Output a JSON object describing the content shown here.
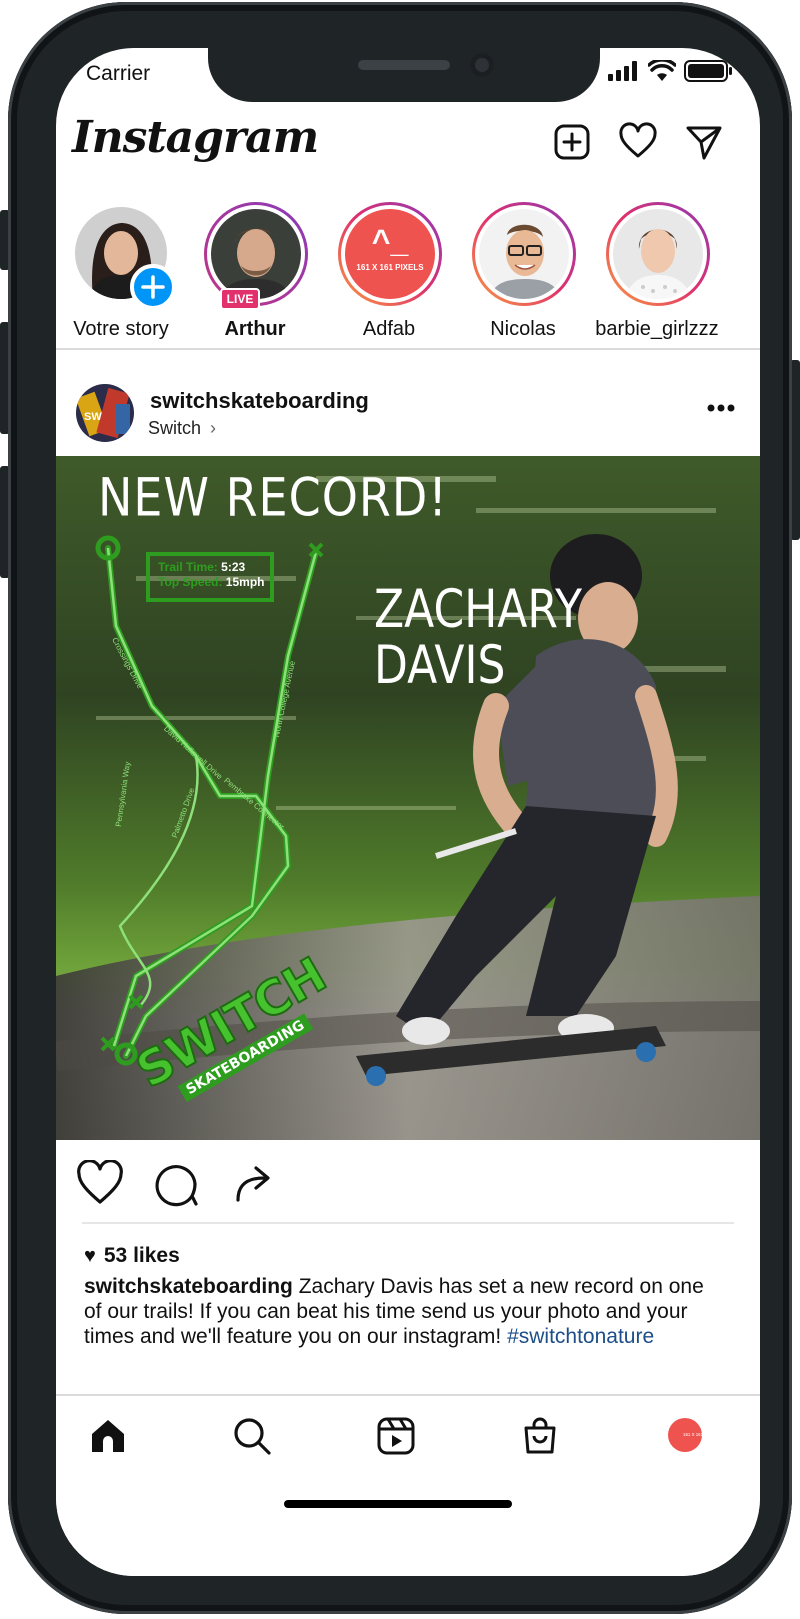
{
  "status_bar": {
    "carrier": "Carrier"
  },
  "header": {
    "logo": "Instagram"
  },
  "stories": [
    {
      "label": "Votre story"
    },
    {
      "label": "Arthur",
      "badge": "LIVE"
    },
    {
      "label": "Adfab",
      "avatar_text": "161 X 161 PIXELS",
      "avatar_glyph": "^_"
    },
    {
      "label": "Nicolas"
    },
    {
      "label": "barbie_girlzzz"
    }
  ],
  "post": {
    "username": "switchskateboarding",
    "location": "Switch",
    "image": {
      "headline": "NEW RECORD!",
      "name_line1": "ZACHARY",
      "name_line2": "DAVIS",
      "trail_time_label": "Trail Time:",
      "trail_time_value": "5:23",
      "top_speed_label": "Top Speed:",
      "top_speed_value": "15mph",
      "brand_main": "SWITCH",
      "brand_sub": "SKATEBOARDING",
      "street_labels": [
        "Crossings Drive",
        "David Hollowell Drive",
        "Pennsylvania Way",
        "North College Avenue",
        "Pembroke Connector",
        "Palmetto Drive"
      ]
    },
    "likes": "53 likes",
    "caption_user": "switchskateboarding",
    "caption_text": "Zachary Davis has set a new record on one of our trails! If you can beat his time send us your photo and your times and we'll feature you on our instagram!",
    "hashtag": "#switchtonature"
  },
  "bottom_nav": {
    "profile_text": "161 X 161 PIXELS"
  },
  "colors": {
    "accent_blue": "#0095f6",
    "live_pink": "#e1306c",
    "trail_green": "#2e9d1f",
    "adfab_red": "#ef5350"
  }
}
